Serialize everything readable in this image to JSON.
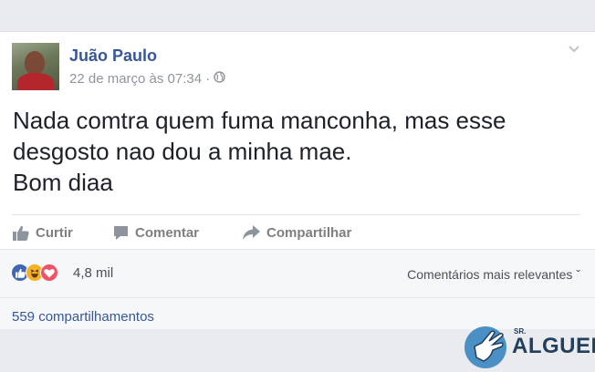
{
  "post": {
    "author": "Juão Paulo",
    "timestamp": "22 de março às 07:34 ·",
    "privacy_icon": "globe-icon",
    "text_lines": [
      "Nada comtra quem fuma manconha, mas esse",
      "desgosto nao dou a minha mae.",
      "Bom diaa"
    ]
  },
  "actions": {
    "like": "Curtir",
    "comment": "Comentar",
    "share": "Compartilhar"
  },
  "reactions": {
    "types": [
      "like",
      "haha",
      "love"
    ],
    "colors": {
      "like": "#4267b2",
      "haha": "#f7b125",
      "love": "#f25268"
    },
    "count": "4,8 mil",
    "sort_label": "Comentários mais relevantes ˇ"
  },
  "shares": {
    "label": "559 compartilhamentos"
  },
  "watermark": {
    "prefix": "SR.",
    "name": "ALGUEM"
  }
}
